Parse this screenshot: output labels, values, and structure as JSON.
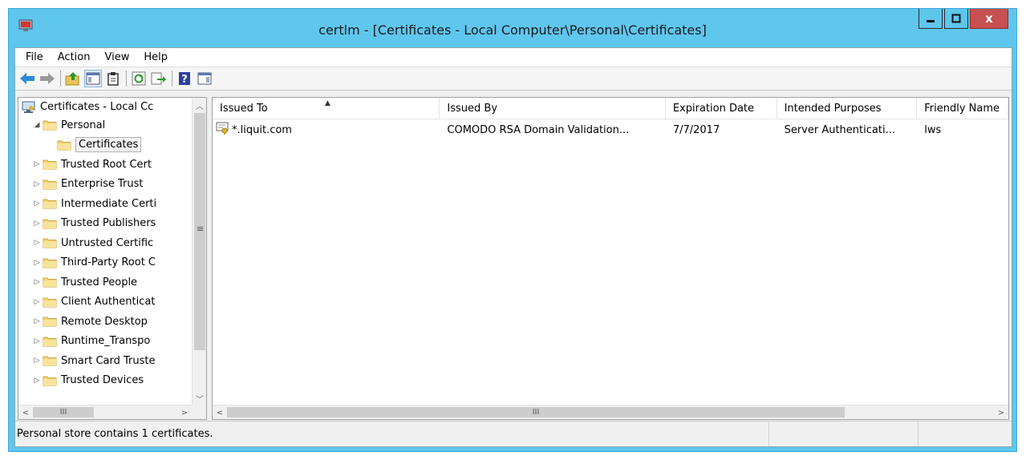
{
  "window": {
    "title": "certlm - [Certificates - Local Computer\\Personal\\Certificates]",
    "close_label": "x"
  },
  "menu": [
    "File",
    "Action",
    "View",
    "Help"
  ],
  "toolbar": {
    "icons": [
      "back-arrow-icon",
      "forward-arrow-icon",
      "up-folder-icon",
      "show-hide-tree-icon",
      "clipboard-icon",
      "refresh-icon",
      "export-list-icon",
      "help-icon",
      "action-pane-icon"
    ]
  },
  "tree": {
    "items": [
      {
        "label": "Certificates - Local Cc",
        "level": 0,
        "expander": "",
        "icon": "computer-cert-icon"
      },
      {
        "label": "Personal",
        "level": 1,
        "expander": "◢",
        "icon": "folder-icon"
      },
      {
        "label": "Certificates",
        "level": 2,
        "expander": "",
        "icon": "folder-icon",
        "selected": true
      },
      {
        "label": "Trusted Root Cert",
        "level": 1,
        "expander": "▷",
        "icon": "folder-icon"
      },
      {
        "label": "Enterprise Trust",
        "level": 1,
        "expander": "▷",
        "icon": "folder-icon"
      },
      {
        "label": "Intermediate Certi",
        "level": 1,
        "expander": "▷",
        "icon": "folder-icon"
      },
      {
        "label": "Trusted Publishers",
        "level": 1,
        "expander": "▷",
        "icon": "folder-icon"
      },
      {
        "label": "Untrusted Certific",
        "level": 1,
        "expander": "▷",
        "icon": "folder-icon"
      },
      {
        "label": "Third-Party Root C",
        "level": 1,
        "expander": "▷",
        "icon": "folder-icon"
      },
      {
        "label": "Trusted People",
        "level": 1,
        "expander": "▷",
        "icon": "folder-icon"
      },
      {
        "label": "Client Authenticat",
        "level": 1,
        "expander": "▷",
        "icon": "folder-icon"
      },
      {
        "label": "Remote Desktop",
        "level": 1,
        "expander": "▷",
        "icon": "folder-icon"
      },
      {
        "label": "Runtime_Transpo",
        "level": 1,
        "expander": "▷",
        "icon": "folder-icon"
      },
      {
        "label": "Smart Card Truste",
        "level": 1,
        "expander": "▷",
        "icon": "folder-icon"
      },
      {
        "label": "Trusted Devices",
        "level": 1,
        "expander": "▷",
        "icon": "folder-icon"
      }
    ]
  },
  "list": {
    "columns": [
      "Issued To",
      "Issued By",
      "Expiration Date",
      "Intended Purposes",
      "Friendly Name"
    ],
    "rows": [
      [
        "*.liquit.com",
        "COMODO RSA Domain Validation...",
        "7/7/2017",
        "Server Authenticati...",
        "lws"
      ]
    ]
  },
  "statusbar": {
    "text": "Personal store contains 1 certificates."
  },
  "colors": {
    "titlebar": "#5fc6ed",
    "close": "#c75050",
    "folder": "#f3d57a"
  }
}
